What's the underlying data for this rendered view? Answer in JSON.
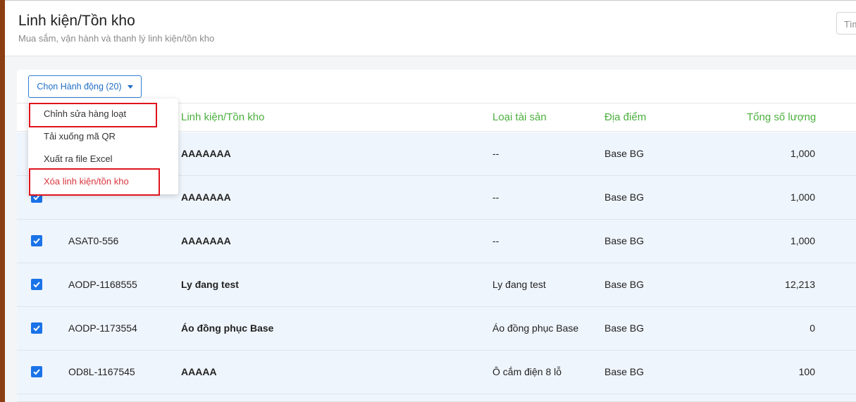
{
  "header": {
    "title": "Linh kiện/Tồn kho",
    "subtitle": "Mua sắm, vận hành và thanh lý linh kiện/tồn kho",
    "search_text": "Tìm"
  },
  "toolbar": {
    "action_button_label": "Chọn Hành động (20)"
  },
  "dropdown": {
    "items": [
      {
        "label": "Chỉnh sửa hàng loạt",
        "highlighted": true
      },
      {
        "label": "Tải xuống mã QR",
        "highlighted": false
      },
      {
        "label": "Xuất ra file Excel",
        "highlighted": false
      },
      {
        "label": "Xóa linh kiện/tồn kho",
        "highlighted": true,
        "danger": true
      }
    ]
  },
  "table": {
    "columns": [
      "Linh kiện/Tồn kho",
      "Loại tài sản",
      "Địa điểm",
      "Tổng số lượng"
    ],
    "rows": [
      {
        "code": "",
        "name": "AAAAAAA",
        "type": "--",
        "location": "Base BG",
        "quantity": "1,000",
        "checked": true
      },
      {
        "code": "",
        "name": "AAAAAAA",
        "type": "--",
        "location": "Base BG",
        "quantity": "1,000",
        "checked": true
      },
      {
        "code": "ASAT0-556",
        "name": "AAAAAAA",
        "type": "--",
        "location": "Base BG",
        "quantity": "1,000",
        "checked": true
      },
      {
        "code": "AODP-1168555",
        "name": "Ly đang test",
        "type": "Ly đang test",
        "location": "Base BG",
        "quantity": "12,213",
        "checked": true
      },
      {
        "code": "AODP-1173554",
        "name": "Áo đồng phục Base",
        "type": "Áo đồng phục Base",
        "location": "Base BG",
        "quantity": "0",
        "checked": true
      },
      {
        "code": "OD8L-1167545",
        "name": "AAAAA",
        "type": "Ô cắm điện 8 lỗ",
        "location": "Base BG",
        "quantity": "100",
        "checked": true
      }
    ]
  },
  "colors": {
    "accent_blue": "#1a73e8",
    "header_green": "#4caf3f",
    "danger_red": "#d9363e",
    "highlight_red": "#e0141d",
    "left_strip": "#8b3e12"
  }
}
